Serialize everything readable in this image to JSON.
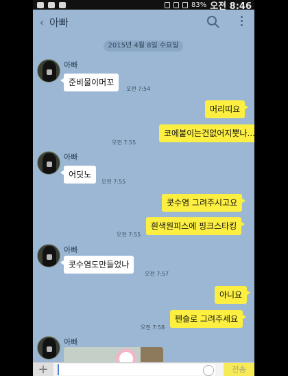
{
  "status_bar": {
    "battery": "83%",
    "time": "오전 8:46"
  },
  "header": {
    "title": "아빠",
    "icons": [
      "back-icon",
      "search-icon",
      "more-icon"
    ]
  },
  "date": "2015년 4월 8일 수요일",
  "sender_name": "아빠",
  "messages": [
    {
      "side": "left",
      "text": "준비물이머꼬",
      "time": "오전 7:54"
    },
    {
      "side": "right",
      "text": "머리띠요",
      "time": ""
    },
    {
      "side": "right",
      "text": "코에붙이는건없어지뿟나...",
      "time": "오전 7:55"
    },
    {
      "side": "left",
      "text": "어딧노",
      "time": "오전 7:55"
    },
    {
      "side": "right",
      "text": "콧수염 그려주시고요",
      "time": ""
    },
    {
      "side": "right",
      "text": "흰색원피스에 핑크스타킹",
      "time": "오전 7:55"
    },
    {
      "side": "left",
      "text": "콧수염도만들었나",
      "time": "오전 7:57"
    },
    {
      "side": "right",
      "text": "아니요",
      "time": ""
    },
    {
      "side": "right",
      "text": "펜슬로 그려주세요",
      "time": "오전 7:58"
    }
  ],
  "input": {
    "send_label": "전송"
  },
  "colors": {
    "background": "#9bb7d4",
    "my_bubble": "#fcef42",
    "their_bubble": "#ffffff"
  }
}
